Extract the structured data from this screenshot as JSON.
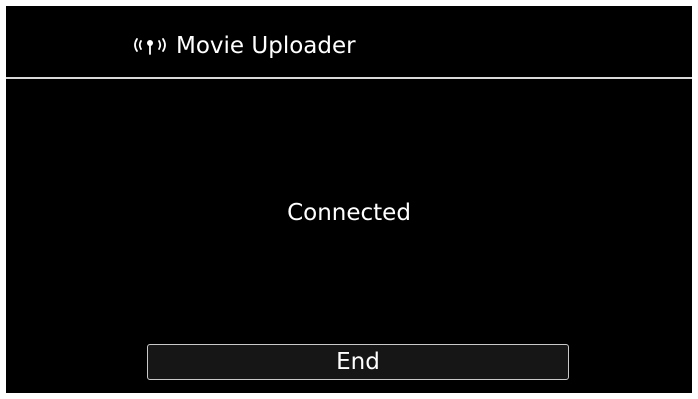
{
  "header": {
    "icon": "wifi-antenna-icon",
    "title": "Movie Uploader"
  },
  "main": {
    "status": "Connected"
  },
  "actions": {
    "end_label": "End"
  },
  "colors": {
    "background": "#000000",
    "text": "#ffffff",
    "divider": "#d8d8d8",
    "button_border": "#c9c9c9"
  }
}
